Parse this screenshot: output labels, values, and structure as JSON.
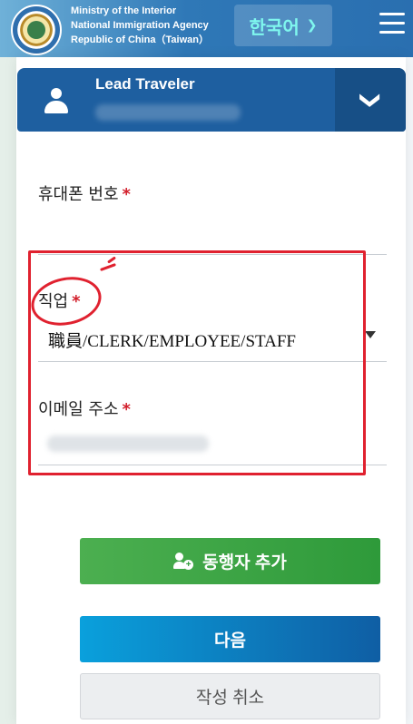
{
  "header": {
    "agency_lines": [
      "Ministry of the Interior",
      "National Immigration Agency",
      "Republic of China（Taiwan）"
    ],
    "language_label": "한국어",
    "language_icon": "chevron-down-icon",
    "menu_icon": "hamburger-menu-icon"
  },
  "lead_traveler": {
    "title": "Lead Traveler",
    "toggle_icon": "chevron-down-icon"
  },
  "form": {
    "phone_label": "휴대폰 번호",
    "occupation_label": "직업",
    "occupation_value": "職員/CLERK/EMPLOYEE/STAFF",
    "email_label": "이메일 주소",
    "required_mark": "*"
  },
  "buttons": {
    "add_companion": "동행자 추가",
    "next": "다음",
    "cancel": "작성 취소"
  },
  "colors": {
    "header_blue": "#2a6fb0",
    "lead_bar": "#1e5fa0",
    "language_text": "#7ff7ee",
    "required": "#d21e2a",
    "annotation_red": "#e0212f",
    "add_green": "#2e9a3a",
    "next_blue": "#0f5ea4"
  }
}
